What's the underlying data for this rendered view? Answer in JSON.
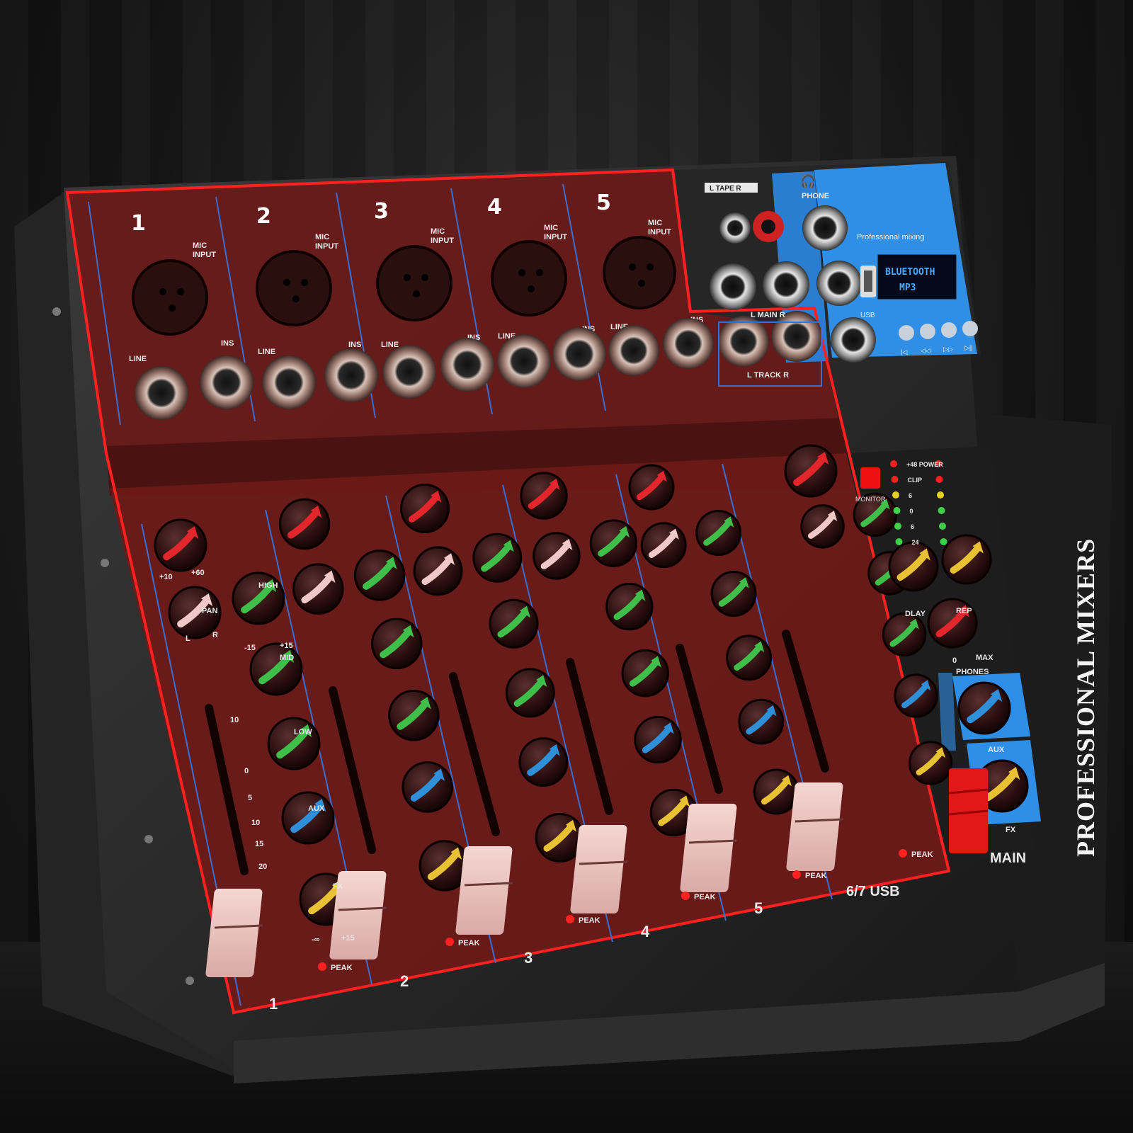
{
  "channels": [
    {
      "number": "1",
      "mic_label": "MIC\nINPUT",
      "line_label": "LINE",
      "ins_label": "INS",
      "bottom_label": "1"
    },
    {
      "number": "2",
      "mic_label": "MIC\nINPUT",
      "line_label": "LINE",
      "ins_label": "INS",
      "bottom_label": "2"
    },
    {
      "number": "3",
      "mic_label": "MIC\nINPUT",
      "line_label": "LINE",
      "ins_label": "INS",
      "bottom_label": "3"
    },
    {
      "number": "4",
      "mic_label": "MIC\nINPUT",
      "line_label": "LINE",
      "ins_label": "INS",
      "bottom_label": "4"
    },
    {
      "number": "5",
      "mic_label": "MIC\nINPUT",
      "line_label": "LINE",
      "ins_label": "INS",
      "bottom_label": "5"
    }
  ],
  "usb_channel_label": "6/7 USB",
  "knob_labels": {
    "gain_min": "+10",
    "gain_max": "+60",
    "pan": "PAN",
    "pan_l": "L",
    "pan_r": "R",
    "high": "HIGH",
    "mid": "MID",
    "low": "LOW",
    "aux": "AUX",
    "fx": "FX",
    "eq_min": "-15",
    "eq_max": "+15",
    "send_min": "-∞",
    "send_max": "+15",
    "peak": "PEAK"
  },
  "fader_scale": [
    "10",
    "0",
    "5",
    "10",
    "15",
    "20"
  ],
  "rear_panel": {
    "tape_label": "L TAPE R",
    "phone_label": "PHONE",
    "main_label": "L MAIN R",
    "track_label": "L TRACK R",
    "usb_label": "USB",
    "brand_line": "Professional mixing",
    "display_lines": [
      "BLUETOOTH",
      "MP3"
    ],
    "player_buttons": [
      "|◁",
      "◁◁",
      "▷▷",
      "▷||"
    ]
  },
  "master_section": {
    "meter_labels": [
      "+48 POWER",
      "CLIP",
      "6",
      "0",
      "6",
      "24"
    ],
    "monitor_label": "MONITOR",
    "delay_label": "DLAY",
    "rep_label": "REP",
    "phones_label": "PHONES",
    "phones_min": "0",
    "phones_max": "MAX",
    "aux_label": "AUX",
    "fx_label": "FX",
    "main_label": "MAIN"
  },
  "side_text": "PROFESSIONAL MIXERS",
  "colors": {
    "gain_knob": "#e2262c",
    "pan_knob": "#f0c8c8",
    "eq_knob": "#3fbf4a",
    "aux_knob": "#2f8fd8",
    "fx_knob": "#e8c232",
    "overlay": "#7a0f0f",
    "outline": "#ff2020",
    "blue_panel": "#2f8fe6"
  }
}
